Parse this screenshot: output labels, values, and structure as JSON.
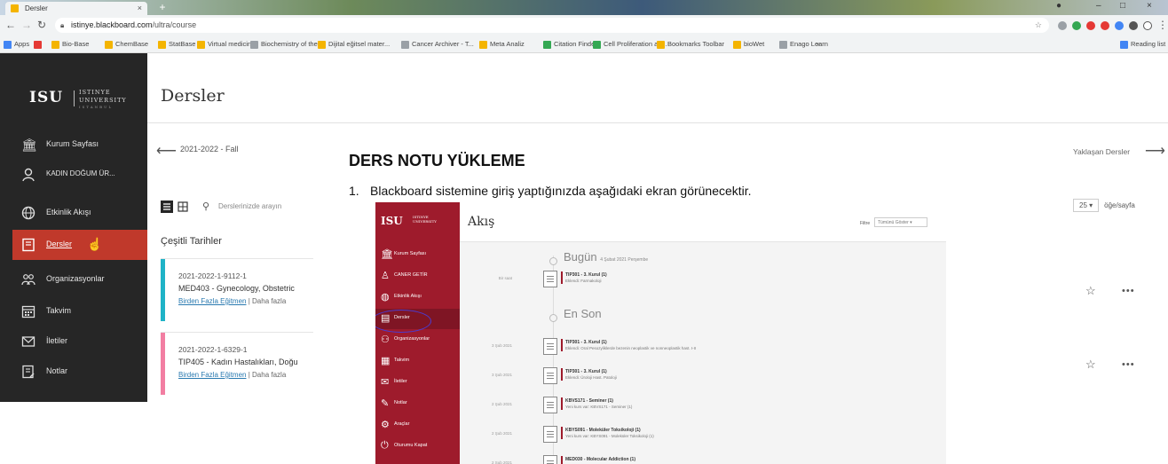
{
  "browser": {
    "tab_title": "Dersler",
    "url_host": "istinye.blackboard.com",
    "url_path": "/ultra/course",
    "bookmarks": [
      {
        "label": "Apps",
        "color": "#4285f4"
      },
      {
        "label": "",
        "color": "#e53935"
      },
      {
        "label": "Bio-Base",
        "color": "#f4b400"
      },
      {
        "label": "ChemBase",
        "color": "#f4b400"
      },
      {
        "label": "StatBase",
        "color": "#f4b400"
      },
      {
        "label": "Virtual medicine",
        "color": "#f4b400"
      },
      {
        "label": "Biochemistry of the...",
        "color": "#9aa0a6"
      },
      {
        "label": "Dijital eğitsel mater...",
        "color": "#f4b400"
      },
      {
        "label": "Cancer Archiver - T...",
        "color": "#9aa0a6"
      },
      {
        "label": "Meta Analiz",
        "color": "#f4b400"
      },
      {
        "label": "Citation Finder",
        "color": "#34a853"
      },
      {
        "label": "Cell Proliferation an...",
        "color": "#34a853"
      },
      {
        "label": "Bookmarks Toolbar",
        "color": "#f4b400"
      },
      {
        "label": "bioWet",
        "color": "#f4b400"
      },
      {
        "label": "Enago Learn",
        "color": "#9aa0a6"
      },
      {
        "label": "»",
        "color": ""
      },
      {
        "label": "Reading list",
        "color": "#4285f4"
      }
    ]
  },
  "sidebar": {
    "logo": {
      "short": "ISU",
      "line1": "ISTINYE",
      "line2": "UNIVERSITY",
      "line3": "ISTANBUL"
    },
    "items": [
      {
        "label": "Kurum Sayfası",
        "icon": "institution-icon"
      },
      {
        "label": "KADIN DOĞUM ÜR...",
        "icon": "person-icon"
      },
      {
        "label": "Etkinlik Akışı",
        "icon": "globe-icon"
      },
      {
        "label": "Dersler",
        "icon": "courses-icon"
      },
      {
        "label": "Organizasyonlar",
        "icon": "organizations-icon"
      },
      {
        "label": "Takvim",
        "icon": "calendar-icon"
      },
      {
        "label": "İletiler",
        "icon": "mail-icon"
      },
      {
        "label": "Notlar",
        "icon": "grades-icon"
      }
    ]
  },
  "main": {
    "title": "Dersler",
    "term": "2021-2022 - Fall",
    "upcoming": "Yaklaşan Dersler",
    "search_placeholder": "Derslerinizde arayın",
    "per_page_value": "25",
    "per_page_label": "öğe/sayfa",
    "section_title": "Çeşitli Tarihler",
    "courses": [
      {
        "id": "2021-2022-1-9112-1",
        "name": "MED403 - Gynecology, Obstetric",
        "instructor": "Birden Fazla Eğitmen",
        "more": "Daha fazla",
        "color": "#1fb3c7"
      },
      {
        "id": "2021-2022-1-6329-1",
        "name": "TIP405 - Kadın Hastalıkları, Doğu",
        "instructor": "Birden Fazla Eğitmen",
        "more": "Daha fazla",
        "color": "#f27ea2"
      }
    ]
  },
  "overlay": {
    "title": "DERS NOTU YÜKLEME",
    "step_number": "1.",
    "step_text": "Blackboard sistemine giriş yaptığınızda aşağıdaki ekran görünecektir.",
    "screenshot": {
      "logo": "ISU",
      "logo_sub": "ISTINYE UNIVERSITY",
      "header_title": "Akış",
      "filter_label": "Filtre",
      "filter_value": "Tümünü Göster",
      "nav": [
        "Kurum Sayfası",
        "CANER GETİR",
        "Etkinlik Akışı",
        "Dersler",
        "Organizasyonlar",
        "Takvim",
        "İletiler",
        "Notlar",
        "Araçlar",
        "Oturumu Kapat"
      ],
      "today_heading": "Bugün",
      "today_date": "4 Şubat 2021 Perşembe",
      "recent_heading": "En Son",
      "items": [
        {
          "date": "Bir saat",
          "title": "TIP301 - 3. Kurul (1)",
          "sub": "Eklendi: Farmakoloji"
        },
        {
          "date": "3 Şub 2021",
          "title": "TIP301 - 3. Kurul (1)",
          "sub": "Eklendi: Oral Pesozyliklerde bezenin neoplastik ve nonneoplastik hast. I-II"
        },
        {
          "date": "3 Şub 2021",
          "title": "TIP301 - 3. Kurul (1)",
          "sub": "Eklendi: Üroloji Hast. Patoloji"
        },
        {
          "date": "2 Şub 2021",
          "title": "KBVS171 - Seminer (1)",
          "sub": "Yeni kurs var: KBVS171 - Seminer (1)"
        },
        {
          "date": "2 Şub 2021",
          "title": "KBYS091 - Moleküler Toksikoloji (1)",
          "sub": "Yeni kurs var: KBYS091 - Moleküler Toksikoloji (1)"
        },
        {
          "date": "2 Şub 2021",
          "title": "MED030 - Molecular Addiction (1)",
          "sub": ""
        }
      ]
    }
  }
}
